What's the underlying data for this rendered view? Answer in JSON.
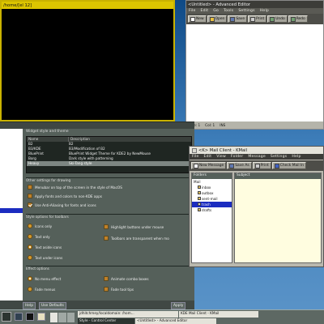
{
  "terminal": {
    "title": "/home/[el 12]"
  },
  "editor": {
    "title": "<Untitled> - Advanced Editor",
    "menu": [
      "File",
      "Edit",
      "Go",
      "Tools",
      "Settings",
      "Help"
    ],
    "toolbar": [
      "New",
      "Open",
      "Save",
      "Print",
      "Undo",
      "Redo"
    ],
    "status": [
      "Line: 1",
      "Col: 1",
      "INS"
    ]
  },
  "kcontrol": {
    "styles_header": "Widget style and theme",
    "col_name": "Name",
    "col_desc": "Description",
    "styles": [
      {
        "name": "B2",
        "desc": "B2"
      },
      {
        "name": "B3/KDE",
        "desc": "B3/Modification of B2"
      },
      {
        "name": "BluePrint",
        "desc": "BluePrint Widget Theme for KDE2 by NewMouse"
      },
      {
        "name": "Borg",
        "desc": "Dark style with patterning"
      },
      {
        "name": "Heavy",
        "desc": "Ski-Tang style"
      }
    ],
    "other_header": "Other settings for drawing",
    "other": [
      {
        "label": "Menubar on top of the screen in the style of MacOS",
        "checked": false
      },
      {
        "label": "Apply fonts and colors to non-KDE apps",
        "checked": false
      },
      {
        "label": "Use Anti-Aliasing for fonts and icons",
        "checked": true
      }
    ],
    "toolbar_header": "Style options for toolbars",
    "toolbar_opts": [
      {
        "label": "Icons only",
        "on": false
      },
      {
        "label": "Text only",
        "on": false
      },
      {
        "label": "Text aside icons",
        "on": true
      },
      {
        "label": "Text under icons",
        "on": false
      }
    ],
    "toolbar_checks": [
      {
        "label": "Highlight buttons under mouse",
        "checked": false
      },
      {
        "label": "Toolbars are transparent when mo",
        "checked": false
      }
    ],
    "effect_header": "Effect options",
    "effect_opts": [
      {
        "label": "No menu effect",
        "on": true
      },
      {
        "label": "Fade menus",
        "on": false
      }
    ],
    "effect_checks": [
      {
        "label": "Animate combo boxes",
        "checked": false
      },
      {
        "label": "Fade tool tips",
        "checked": false
      }
    ],
    "buttons": {
      "help": "Help",
      "defaults": "Use Defaults",
      "apply": "Apply"
    }
  },
  "mail": {
    "title": "<K> Mail Client - KMail",
    "menu": [
      "File",
      "Edit",
      "View",
      "Folder",
      "Message",
      "Settings",
      "Help"
    ],
    "toolbar": [
      "New Message",
      "Save As",
      "Print",
      "Check Mail In"
    ],
    "folders_header": "Folders",
    "root": "Mail",
    "folders": [
      {
        "name": "inbox",
        "selected": false
      },
      {
        "name": "outbox",
        "selected": false
      },
      {
        "name": "sent-mail",
        "selected": false
      },
      {
        "name": "trash",
        "selected": true
      },
      {
        "name": "drafts",
        "selected": false
      }
    ],
    "subject_header": "Subject"
  },
  "taskbar": {
    "tasks": [
      {
        "label": "jdhitchmey/localdomain: /hom..."
      },
      {
        "label": "KDE Mail Client - KMail"
      },
      {
        "label": "Style - Control Center"
      },
      {
        "label": "<Untitled> - Advanced Editor"
      }
    ]
  },
  "colors": {
    "panel": "#55605a",
    "dark": "#1c2420",
    "chrome": "#b8b7ad",
    "accent": "#c08028"
  }
}
